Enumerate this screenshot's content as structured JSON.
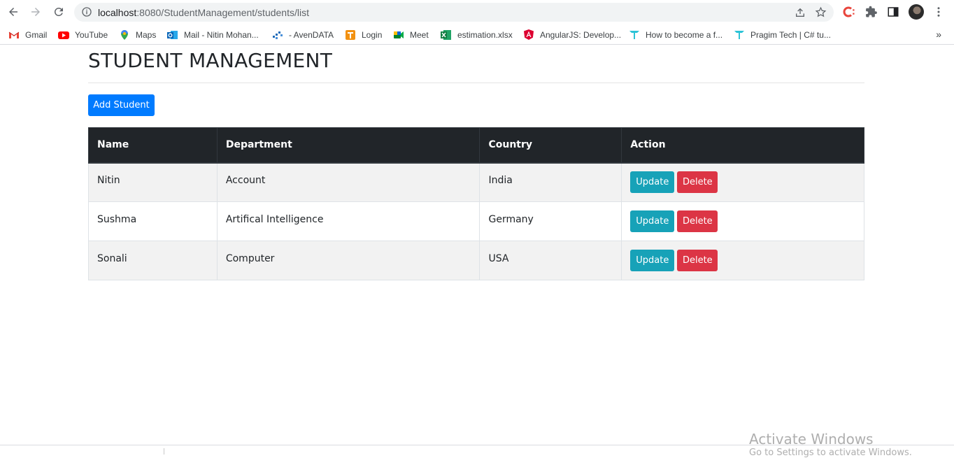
{
  "browser": {
    "url_host": "localhost",
    "url_rest": ":8080/StudentManagement/students/list",
    "icons": [
      "back-arrow-icon",
      "forward-arrow-icon",
      "reload-icon",
      "info-icon",
      "share-icon",
      "star-icon",
      "extension-c-icon",
      "puzzle-icon",
      "side-panel-icon",
      "profile-avatar",
      "kebab-menu-icon"
    ]
  },
  "bookmarks": [
    {
      "label": "Gmail",
      "icon": "gmail-icon"
    },
    {
      "label": "YouTube",
      "icon": "youtube-icon"
    },
    {
      "label": "Maps",
      "icon": "maps-icon"
    },
    {
      "label": "Mail - Nitin Mohan...",
      "icon": "outlook-icon"
    },
    {
      "label": "- AvenDATA",
      "icon": "avendata-icon"
    },
    {
      "label": "Login",
      "icon": "login-icon"
    },
    {
      "label": "Meet",
      "icon": "meet-icon"
    },
    {
      "label": "estimation.xlsx",
      "icon": "excel-icon"
    },
    {
      "label": "AngularJS: Develop...",
      "icon": "angular-icon"
    },
    {
      "label": "How to become a f...",
      "icon": "pragim-icon"
    },
    {
      "label": "Pragim Tech | C# tu...",
      "icon": "pragim-icon"
    }
  ],
  "bookmarks_more": "»",
  "page": {
    "title": "STUDENT MANAGEMENT",
    "add_button": "Add Student"
  },
  "table": {
    "headers": [
      "Name",
      "Department",
      "Country",
      "Action"
    ],
    "rows": [
      {
        "name": "Nitin",
        "department": "Account",
        "country": "India"
      },
      {
        "name": "Sushma",
        "department": "Artifical Intelligence",
        "country": "Germany"
      },
      {
        "name": "Sonali",
        "department": "Computer",
        "country": "USA"
      }
    ],
    "update_label": "Update",
    "delete_label": "Delete"
  },
  "watermark": {
    "line1": "Activate Windows",
    "line2": "Go to Settings to activate Windows."
  },
  "colors": {
    "primary": "#007bff",
    "info": "#17a2b8",
    "danger": "#dc3545",
    "dark_header": "#212529"
  }
}
